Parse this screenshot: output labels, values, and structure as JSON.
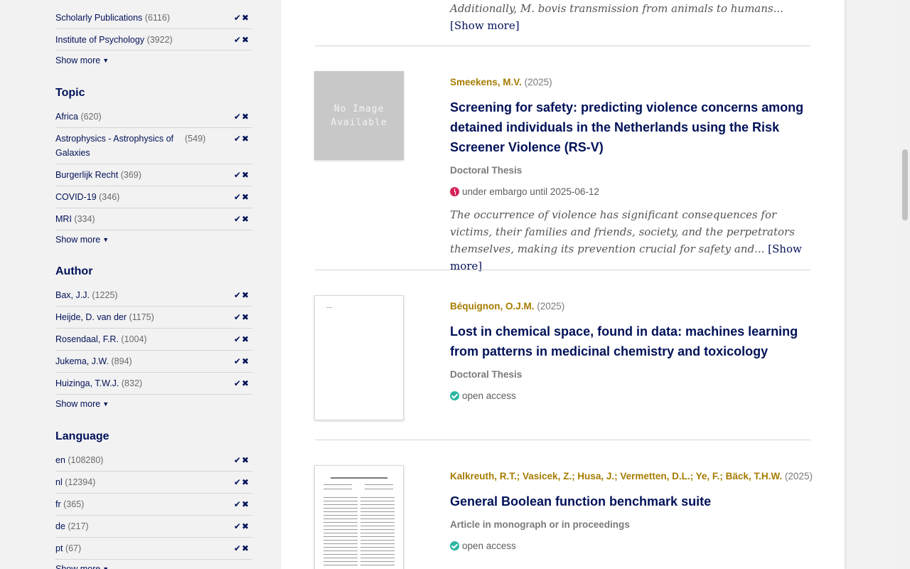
{
  "sidebar": {
    "collection_rows": [
      {
        "label": "Scholarly Publications",
        "count": "(6116)"
      },
      {
        "label": "Institute of Psychology",
        "count": "(3922)"
      }
    ],
    "show_more_label": "Show more",
    "topic": {
      "heading": "Topic",
      "rows": [
        {
          "label": "Africa",
          "count": "(620)"
        },
        {
          "label": "Astrophysics - Astrophysics of Galaxies",
          "count": "(549)"
        },
        {
          "label": "Burgerlijk Recht",
          "count": "(369)"
        },
        {
          "label": "COVID-19",
          "count": "(346)"
        },
        {
          "label": "MRI",
          "count": "(334)"
        }
      ]
    },
    "author": {
      "heading": "Author",
      "rows": [
        {
          "label": "Bax, J.J.",
          "count": "(1225)"
        },
        {
          "label": "Heijde, D. van der",
          "count": "(1175)"
        },
        {
          "label": "Rosendaal, F.R.",
          "count": "(1004)"
        },
        {
          "label": "Jukema, J.W.",
          "count": "(894)"
        },
        {
          "label": "Huizinga, T.W.J.",
          "count": "(832)"
        }
      ]
    },
    "language": {
      "heading": "Language",
      "rows": [
        {
          "label": "en",
          "count": "(108280)"
        },
        {
          "label": "nl",
          "count": "(12394)"
        },
        {
          "label": "fr",
          "count": "(365)"
        },
        {
          "label": "de",
          "count": "(217)"
        },
        {
          "label": "pt",
          "count": "(67)"
        }
      ]
    },
    "include_icon": "check-icon",
    "exclude_icon": "x-icon"
  },
  "results": {
    "top_snippet": "Additionally, M. bovis transmission from animals to humans...",
    "show_more": "[Show more]",
    "items": [
      {
        "authors": "Smeekens, M.V.",
        "year": "(2025)",
        "thumbnail_text": "No Image Available",
        "title": "Screening for safety: predicting violence concerns among detained individuals in the Netherlands using the Risk Screener Violence (RS-V)",
        "type": "Doctoral Thesis",
        "status": "under embargo until 2025-06-12",
        "status_icon": "clock-icon",
        "abstract": "The occurrence of violence has significant consequences for victims, their families and friends, society, and the perpetrators themselves, making its prevention crucial for safety and..."
      },
      {
        "authors": "Béquignon, O.J.M.",
        "year": "(2025)",
        "title": "Lost in chemical space, found in data: machines learning from patterns in medicinal chemistry and toxicology",
        "type": "Doctoral Thesis",
        "status": "open access",
        "status_icon": "check-circle-icon"
      },
      {
        "authors": "Kalkreuth, R.T.; Vasicek, Z.; Husa, J.; Vermetten, D.L.; Ye, F.; Bäck, T.H.W.",
        "year": "(2025)",
        "title": "General Boolean function benchmark suite",
        "type": "Article in monograph or in proceedings",
        "status": "open access",
        "status_icon": "check-circle-icon"
      }
    ]
  },
  "colors": {
    "link": "#001158",
    "author": "#a67c00",
    "embargo": "#d6245a",
    "open_access": "#2cb7a1"
  }
}
